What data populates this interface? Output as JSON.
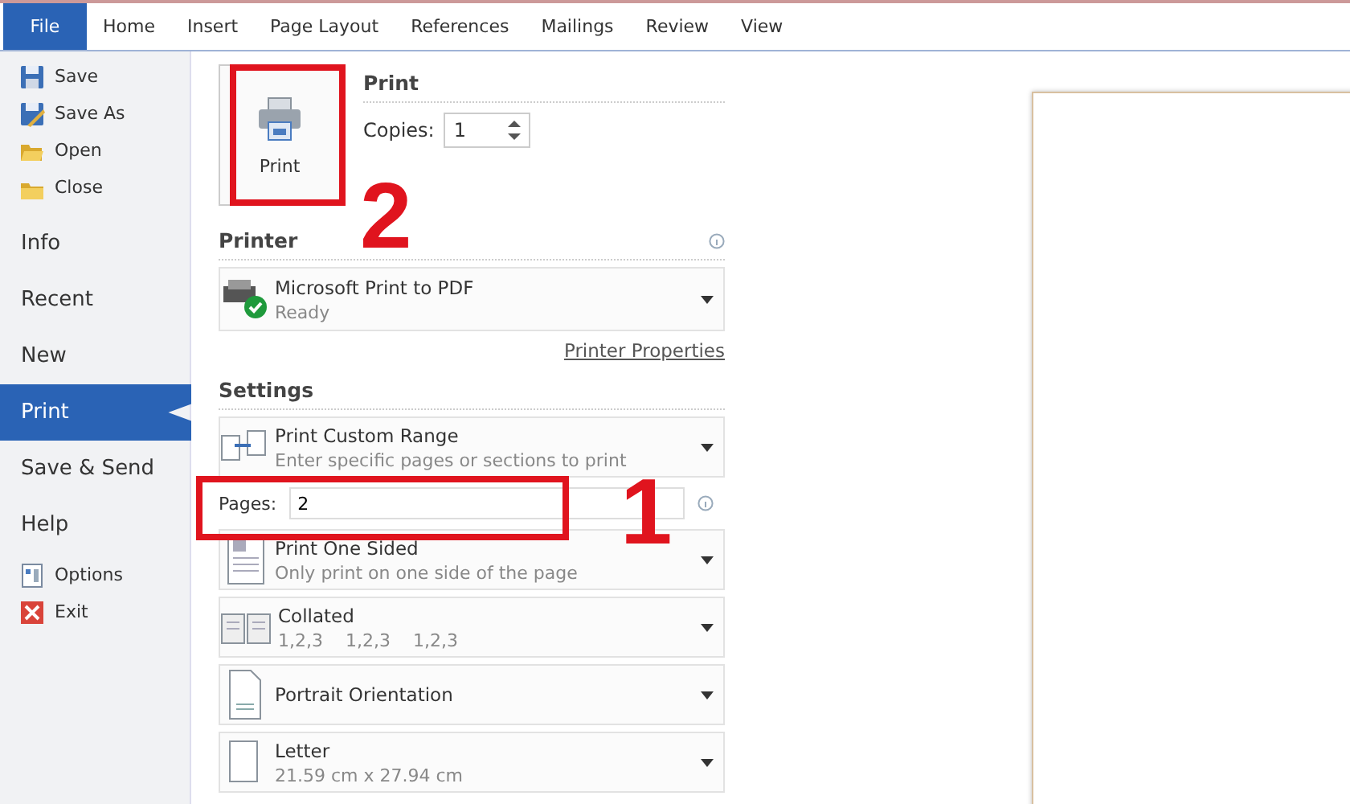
{
  "ribbon_tabs": [
    {
      "label": "File",
      "selected": true
    },
    {
      "label": "Home",
      "selected": false
    },
    {
      "label": "Insert",
      "selected": false
    },
    {
      "label": "Page Layout",
      "selected": false
    },
    {
      "label": "References",
      "selected": false
    },
    {
      "label": "Mailings",
      "selected": false
    },
    {
      "label": "Review",
      "selected": false
    },
    {
      "label": "View",
      "selected": false
    }
  ],
  "sidebar": {
    "items": [
      {
        "kind": "save",
        "label": "Save",
        "selected": false
      },
      {
        "kind": "saveas",
        "label": "Save As",
        "selected": false
      },
      {
        "kind": "open",
        "label": "Open",
        "selected": false
      },
      {
        "kind": "close",
        "label": "Close",
        "selected": false
      },
      {
        "kind": "page",
        "label": "Info",
        "selected": false
      },
      {
        "kind": "page",
        "label": "Recent",
        "selected": false
      },
      {
        "kind": "page",
        "label": "New",
        "selected": false
      },
      {
        "kind": "page",
        "label": "Print",
        "selected": true
      },
      {
        "kind": "page",
        "label": "Save & Send",
        "selected": false
      },
      {
        "kind": "page",
        "label": "Help",
        "selected": false
      },
      {
        "kind": "options",
        "label": "Options",
        "selected": false
      },
      {
        "kind": "exit",
        "label": "Exit",
        "selected": false
      }
    ]
  },
  "print": {
    "button": "Print",
    "heading": "Print",
    "copies_label": "Copies:",
    "copies": "1"
  },
  "printer": {
    "heading": "Printer",
    "name": "Microsoft Print to PDF",
    "status": "Ready",
    "properties_link": "Printer Properties"
  },
  "settings": {
    "heading": "Settings",
    "pages_label": "Pages:",
    "pages": "2",
    "options": [
      {
        "kind": "range",
        "title": "Print Custom Range",
        "subtitle": "Enter specific pages or sections to print"
      },
      {
        "kind": "sides",
        "title": "Print One Sided",
        "subtitle": "Only print on one side of the page"
      },
      {
        "kind": "collate",
        "title": "Collated",
        "subtitle": "1,2,3    1,2,3    1,2,3"
      },
      {
        "kind": "orientation",
        "title": "Portrait Orientation"
      },
      {
        "kind": "paper",
        "title": "Letter",
        "subtitle": "21.59 cm x 27.94 cm"
      }
    ]
  },
  "annotations": [
    {
      "label": "2"
    },
    {
      "label": "1"
    }
  ]
}
